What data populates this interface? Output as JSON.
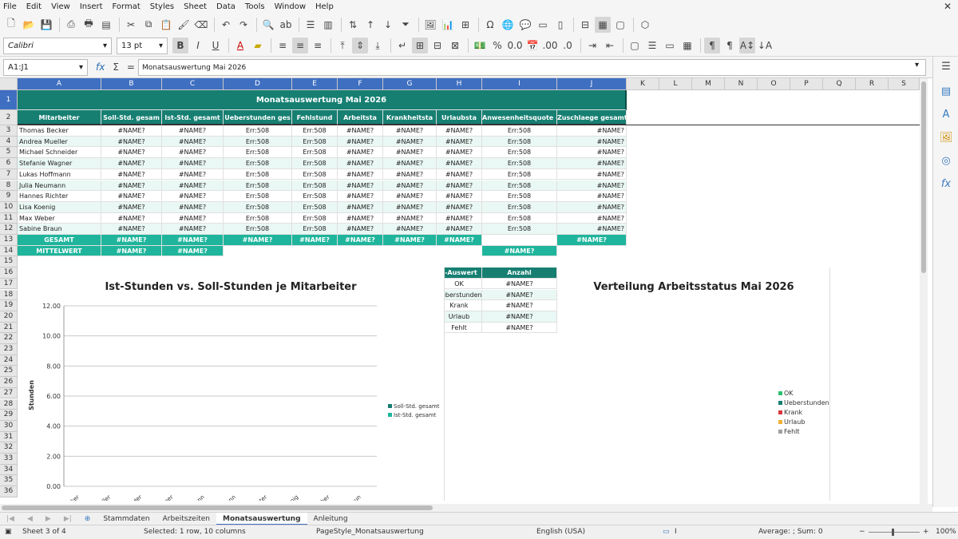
{
  "menu": [
    "File",
    "Edit",
    "View",
    "Insert",
    "Format",
    "Styles",
    "Sheet",
    "Data",
    "Tools",
    "Window",
    "Help"
  ],
  "toolbar2": {
    "font_name": "Calibri",
    "font_size": "13 pt"
  },
  "formula": {
    "namebox": "A1:J1",
    "content": "Monatsauswertung Mai 2026"
  },
  "columns": [
    "A",
    "B",
    "C",
    "D",
    "E",
    "F",
    "G",
    "H",
    "I",
    "J",
    "K",
    "L",
    "M",
    "N",
    "O",
    "P",
    "Q",
    "R",
    "S"
  ],
  "rows": [
    "1",
    "2",
    "3",
    "4",
    "5",
    "6",
    "7",
    "8",
    "9",
    "10",
    "11",
    "12",
    "13",
    "14",
    "15",
    "16",
    "17",
    "18",
    "19",
    "20",
    "21",
    "22",
    "23",
    "24",
    "25",
    "26",
    "27",
    "28",
    "29",
    "30",
    "31",
    "32",
    "33",
    "34",
    "35",
    "36"
  ],
  "sheet": {
    "title": "Monatsauswertung Mai 2026",
    "headers": [
      "Mitarbeiter",
      "Soll-Std. gesam",
      "Ist-Std. gesamt",
      "Ueberstunden ges",
      "Fehlstund",
      "Arbeitsta",
      "Krankheitsta",
      "Urlaubsta",
      "Anwesenheitsquote (",
      "Zuschlaege gesamt (E"
    ],
    "employees": [
      {
        "name": "Thomas Becker",
        "b": "#NAME?",
        "c": "#NAME?",
        "d": "Err:508",
        "e": "Err:508",
        "f": "#NAME?",
        "g": "#NAME?",
        "h": "#NAME?",
        "i": "Err:508",
        "j": "#NAME?"
      },
      {
        "name": "Andrea Mueller",
        "b": "#NAME?",
        "c": "#NAME?",
        "d": "Err:508",
        "e": "Err:508",
        "f": "#NAME?",
        "g": "#NAME?",
        "h": "#NAME?",
        "i": "Err:508",
        "j": "#NAME?"
      },
      {
        "name": "Michael Schneider",
        "b": "#NAME?",
        "c": "#NAME?",
        "d": "Err:508",
        "e": "Err:508",
        "f": "#NAME?",
        "g": "#NAME?",
        "h": "#NAME?",
        "i": "Err:508",
        "j": "#NAME?"
      },
      {
        "name": "Stefanie Wagner",
        "b": "#NAME?",
        "c": "#NAME?",
        "d": "Err:508",
        "e": "Err:508",
        "f": "#NAME?",
        "g": "#NAME?",
        "h": "#NAME?",
        "i": "Err:508",
        "j": "#NAME?"
      },
      {
        "name": "Lukas Hoffmann",
        "b": "#NAME?",
        "c": "#NAME?",
        "d": "Err:508",
        "e": "Err:508",
        "f": "#NAME?",
        "g": "#NAME?",
        "h": "#NAME?",
        "i": "Err:508",
        "j": "#NAME?"
      },
      {
        "name": "Julia Neumann",
        "b": "#NAME?",
        "c": "#NAME?",
        "d": "Err:508",
        "e": "Err:508",
        "f": "#NAME?",
        "g": "#NAME?",
        "h": "#NAME?",
        "i": "Err:508",
        "j": "#NAME?"
      },
      {
        "name": "Hannes Richter",
        "b": "#NAME?",
        "c": "#NAME?",
        "d": "Err:508",
        "e": "Err:508",
        "f": "#NAME?",
        "g": "#NAME?",
        "h": "#NAME?",
        "i": "Err:508",
        "j": "#NAME?"
      },
      {
        "name": "Lisa Koenig",
        "b": "#NAME?",
        "c": "#NAME?",
        "d": "Err:508",
        "e": "Err:508",
        "f": "#NAME?",
        "g": "#NAME?",
        "h": "#NAME?",
        "i": "Err:508",
        "j": "#NAME?"
      },
      {
        "name": "Max Weber",
        "b": "#NAME?",
        "c": "#NAME?",
        "d": "Err:508",
        "e": "Err:508",
        "f": "#NAME?",
        "g": "#NAME?",
        "h": "#NAME?",
        "i": "Err:508",
        "j": "#NAME?"
      },
      {
        "name": "Sabine Braun",
        "b": "#NAME?",
        "c": "#NAME?",
        "d": "Err:508",
        "e": "Err:508",
        "f": "#NAME?",
        "g": "#NAME?",
        "h": "#NAME?",
        "i": "Err:508",
        "j": "#NAME?"
      }
    ],
    "gesamt": {
      "label": "GESAMT",
      "b": "#NAME?",
      "c": "#NAME?",
      "d": "#NAME?",
      "e": "#NAME?",
      "f": "#NAME?",
      "g": "#NAME?",
      "h": "#NAME?",
      "i": "",
      "j": "#NAME?"
    },
    "mittel": {
      "label": "MITTELWERT",
      "b": "#NAME?",
      "c": "#NAME?",
      "i": "#NAME?"
    },
    "status_table": {
      "header": [
        "s-Auswert",
        "Anzahl"
      ],
      "rows": [
        [
          "OK",
          "#NAME?"
        ],
        [
          "Ueberstunden",
          "#NAME?"
        ],
        [
          "Krank",
          "#NAME?"
        ],
        [
          "Urlaub",
          "#NAME?"
        ],
        [
          "Fehlt",
          "#NAME?"
        ]
      ]
    }
  },
  "chart_data": [
    {
      "type": "bar",
      "title": "Ist-Stunden vs. Soll-Stunden je Mitarbeiter",
      "ylabel": "Stunden",
      "xlabel": "",
      "ylim": [
        0,
        12
      ],
      "yticks": [
        "0.00",
        "2.00",
        "4.00",
        "6.00",
        "8.00",
        "10.00",
        "12.00"
      ],
      "categories": [
        "Thomas Becker",
        "Andrea Mueller",
        "Michael Schneider",
        "Stefanie Wagner",
        "Lukas Hoffmann",
        "Julia Neumann",
        "Hannes Richter",
        "Lisa Koenig",
        "Max Weber",
        "Sabine Braun"
      ],
      "category_labels_visible": [
        "ecker",
        "ueller",
        "neider",
        "agner",
        "mann",
        "mann",
        "ichter",
        "enig",
        "Veber",
        "Braun"
      ],
      "series": [
        {
          "name": "Soll-Std. gesamt",
          "color": "#167f72",
          "values": []
        },
        {
          "name": "Ist-Std. gesamt",
          "color": "#1fb59c",
          "values": []
        }
      ],
      "legend": "right"
    },
    {
      "type": "pie",
      "title": "Verteilung Arbeitsstatus Mai 2026",
      "categories": [
        "OK",
        "Ueberstunden",
        "Krank",
        "Urlaub",
        "Fehlt"
      ],
      "colors": [
        "#2fbf71",
        "#167f72",
        "#d9363e",
        "#f2b134",
        "#a0a0a0"
      ],
      "values": [],
      "legend": "right"
    }
  ],
  "tabs": [
    "Stammdaten",
    "Arbeitszeiten",
    "Monatsauswertung",
    "Anleitung"
  ],
  "status": {
    "sheet": "Sheet 3 of 4",
    "selection": "Selected: 1 row, 10 columns",
    "pagestyle": "PageStyle_Monatsauswertung",
    "lang": "English (USA)",
    "sum": "Average: ; Sum: 0",
    "zoom": "100%"
  }
}
